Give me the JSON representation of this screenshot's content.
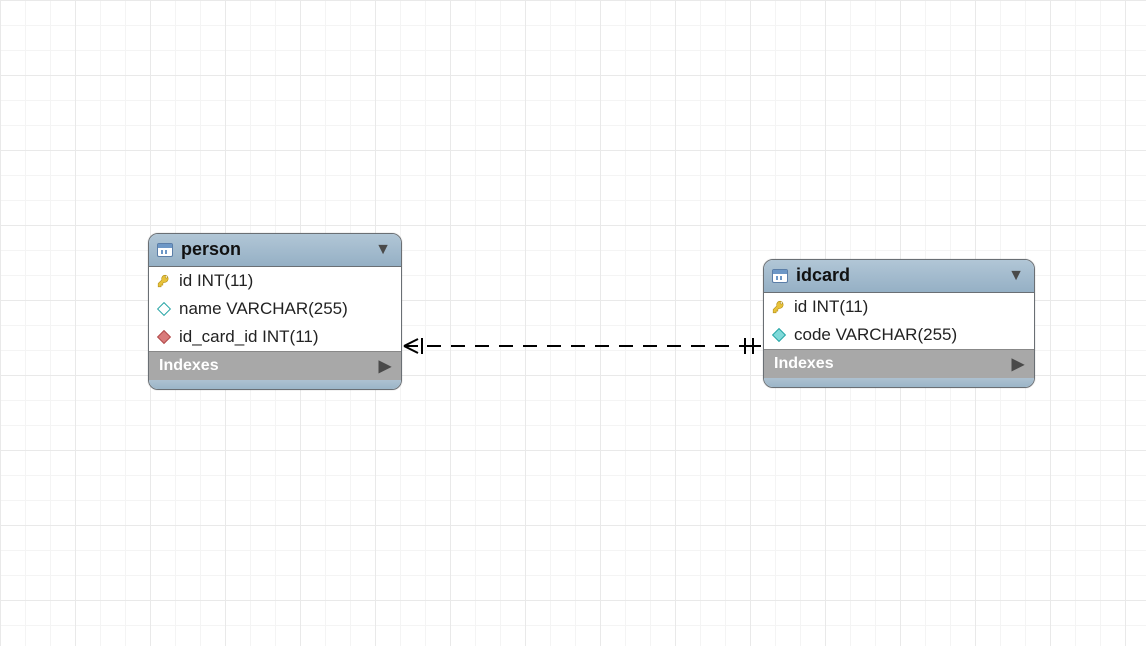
{
  "tables": {
    "person": {
      "title": "person",
      "columns": [
        {
          "icon": "key",
          "label": "id INT(11)"
        },
        {
          "icon": "hollow-cyan",
          "label": "name VARCHAR(255)"
        },
        {
          "icon": "filled-red",
          "label": "id_card_id INT(11)"
        }
      ],
      "footer": "Indexes"
    },
    "idcard": {
      "title": "idcard",
      "columns": [
        {
          "icon": "key",
          "label": "id INT(11)"
        },
        {
          "icon": "filled-cyan",
          "label": "code VARCHAR(255)"
        }
      ],
      "footer": "Indexes"
    }
  },
  "relationship": {
    "from": "person",
    "to": "idcard",
    "style": "dashed",
    "left_notation": "crows-foot-one",
    "right_notation": "one-one"
  }
}
